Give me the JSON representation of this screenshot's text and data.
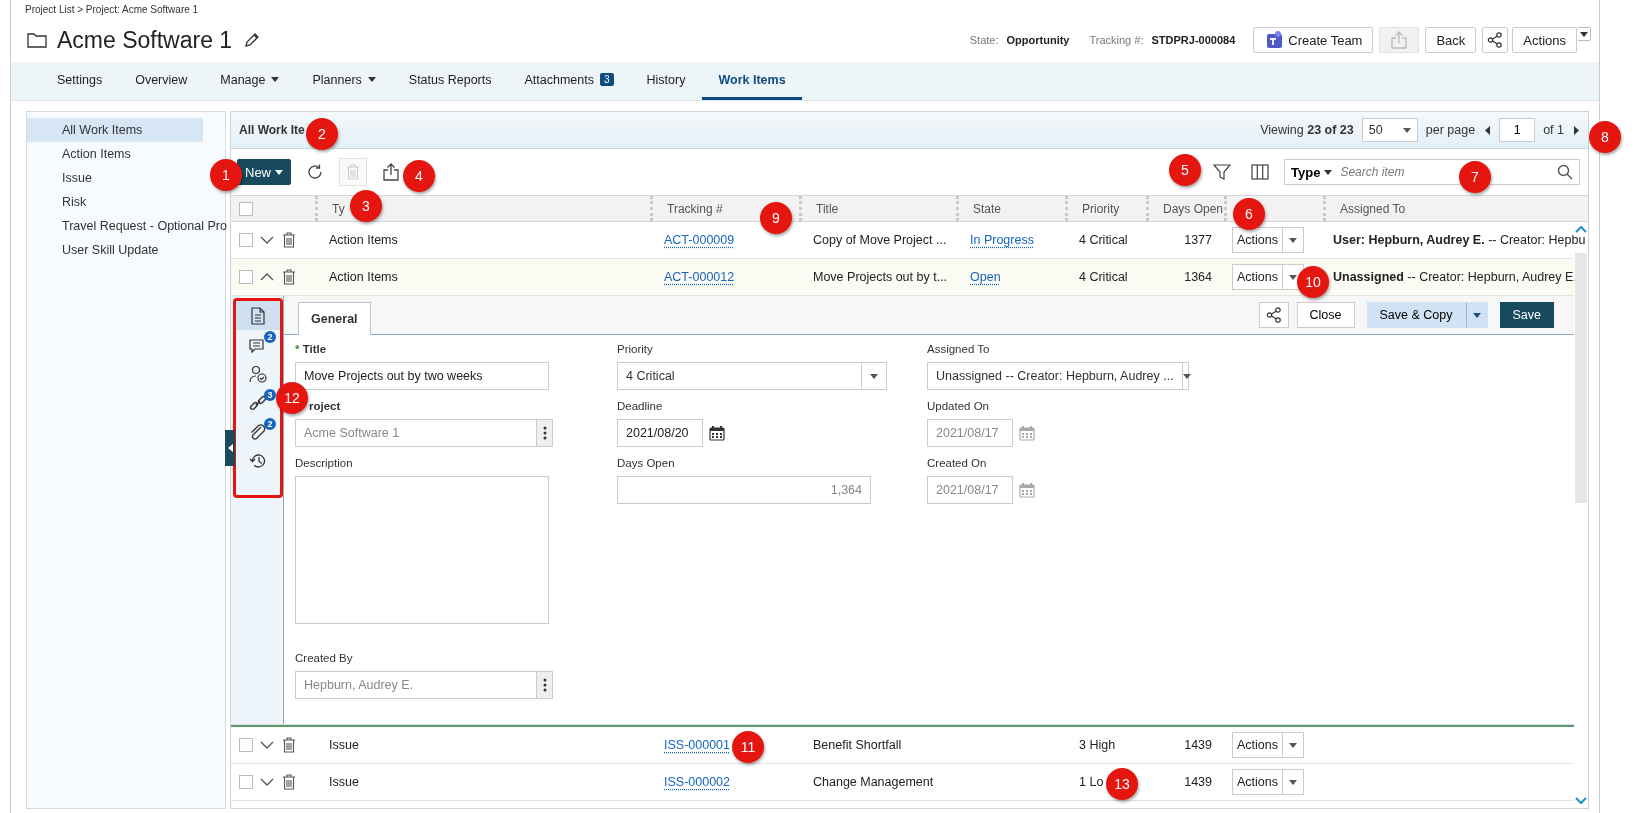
{
  "breadcrumb": "Project List > Project: Acme Software 1",
  "title": "Acme Software 1",
  "header": {
    "state_label": "State:",
    "state": "Opportunity",
    "tracking_label": "Tracking #:",
    "tracking": "STDPRJ-000084",
    "buttons": [
      {
        "kind": "teams",
        "label": "Create Team"
      },
      {
        "kind": "export",
        "disabled": true
      },
      {
        "kind": "text",
        "label": "Back"
      },
      {
        "kind": "share"
      },
      {
        "kind": "split",
        "label": "Actions"
      }
    ]
  },
  "nav_tabs": [
    {
      "label": "Settings",
      "selected": false
    },
    {
      "label": "Overview",
      "selected": false
    },
    {
      "label": "Manage",
      "selected": false,
      "menu": true
    },
    {
      "label": "Planners",
      "selected": false,
      "menu": true
    },
    {
      "label": "Status Reports",
      "selected": false
    },
    {
      "label": "Attachments",
      "selected": false,
      "badge": "3"
    },
    {
      "label": "History",
      "selected": false
    },
    {
      "label": "Work Items",
      "selected": true
    }
  ],
  "sidebar": {
    "items": [
      {
        "label": "All Work Items",
        "selected": true
      },
      {
        "label": "Action Items",
        "selected": false
      },
      {
        "label": "Issue",
        "selected": false
      },
      {
        "label": "Risk",
        "selected": false
      },
      {
        "label": "Travel Request - Optional Pro",
        "selected": false
      },
      {
        "label": "User Skill Update",
        "selected": false
      }
    ]
  },
  "grid": {
    "title": "All Work Ite",
    "viewing": "Viewing **23 of 23**",
    "per_page_value": "50",
    "per_page_label": "per page",
    "page": "1",
    "page_count": "of 1",
    "toolbar": [
      {
        "kind": "new",
        "label": "New"
      },
      {
        "kind": "refresh",
        "disabled": false
      },
      {
        "kind": "delete",
        "disabled": true
      },
      {
        "kind": "export",
        "disabled": false
      }
    ],
    "search": {
      "type_label": "Type",
      "placeholder": "Search item"
    },
    "header_checked": false,
    "columns": [
      {
        "kind": "text",
        "label": "Ty"
      },
      {
        "kind": "text",
        "label": "Tracking #"
      },
      {
        "kind": "text",
        "label": "Title"
      },
      {
        "kind": "text",
        "label": "State"
      },
      {
        "kind": "text",
        "label": "Priority"
      },
      {
        "kind": "text",
        "label": "Days Open"
      },
      {
        "kind": "blank"
      },
      {
        "kind": "text",
        "label": "Assigned To"
      }
    ],
    "rows": [
      {
        "checked": false,
        "expanded": false,
        "type": "Action Items",
        "tracking": "ACT-000009",
        "title": "Copy of Move Project ...",
        "state": "In Progress",
        "priority": "4 Critical",
        "days_open": "1377",
        "action": "Actions",
        "assigned": "**User: Hepburn, Audrey E.** -- Creator: Hepbu"
      },
      {
        "checked": false,
        "expanded": true,
        "type": "Action Items",
        "tracking": "ACT-000012",
        "title": "Move Projects out by t...",
        "state": "Open",
        "priority": "4 Critical",
        "days_open": "1364",
        "action": "Actions",
        "assigned": "**Unassigned** -- Creator: Hepburn, Audrey E."
      },
      {
        "checked": false,
        "expanded": false,
        "type": "Issue",
        "tracking": "ISS-000001",
        "title": "Benefit Shortfall",
        "priority": "3 High",
        "days_open": "1439",
        "action": "Actions"
      },
      {
        "checked": false,
        "expanded": false,
        "type": "Issue",
        "tracking": "ISS-000002",
        "title": "Change Management",
        "priority": "1 Lo",
        "days_open": "1439",
        "action": "Actions"
      }
    ]
  },
  "detail": {
    "side_icons": [
      {
        "kind": "document",
        "selected": true
      },
      {
        "kind": "comments",
        "badge": "2",
        "selected": false
      },
      {
        "kind": "user-check",
        "selected": false
      },
      {
        "kind": "link",
        "badge": "3",
        "selected": false
      },
      {
        "kind": "paperclip",
        "badge": "2",
        "selected": false
      },
      {
        "kind": "history",
        "selected": false
      }
    ],
    "tabs": [
      {
        "label": "General",
        "selected": true
      }
    ],
    "buttons": [
      {
        "kind": "share"
      },
      {
        "kind": "close",
        "label": "Close"
      },
      {
        "kind": "split",
        "label": "Save & Copy"
      },
      {
        "kind": "primary",
        "label": "Save"
      }
    ],
    "columns": [
      [
        {
          "kind": "text",
          "label": "Title",
          "marker": "*",
          "required": true,
          "value": "Move Projects out by two weeks",
          "disabled": false
        },
        {
          "kind": "picker",
          "label": "roject",
          "required": true,
          "value": "Acme Software 1",
          "disabled": true
        },
        {
          "kind": "textarea",
          "label": "Description",
          "required": false
        },
        {
          "kind": "picker",
          "label": "Created By",
          "required": false,
          "value": "Hepburn, Audrey E.",
          "disabled": true
        }
      ],
      [
        {
          "kind": "select",
          "label": "Priority",
          "required": false,
          "value": "4 Critical",
          "disabled": false
        },
        {
          "kind": "date",
          "label": "Deadline",
          "required": false,
          "value": "2021/08/20",
          "disabled": false
        },
        {
          "kind": "number",
          "label": "Days Open",
          "required": false,
          "value": "1,364",
          "disabled": true
        }
      ],
      [
        {
          "kind": "select",
          "label": "Assigned To",
          "required": false,
          "value": "Unassigned -- Creator: Hepburn, Audrey ...",
          "disabled": false
        },
        {
          "kind": "date",
          "label": "Updated On",
          "required": false,
          "value": "2021/08/17",
          "disabled": true
        },
        {
          "kind": "date",
          "label": "Created On",
          "required": false,
          "value": "2021/08/17",
          "disabled": true
        }
      ]
    ]
  },
  "callouts": [
    {
      "number": "1"
    },
    {
      "number": "2"
    },
    {
      "number": "3"
    },
    {
      "number": "4"
    },
    {
      "number": "5"
    },
    {
      "number": "6"
    },
    {
      "number": "7"
    },
    {
      "number": "8"
    },
    {
      "number": "9"
    },
    {
      "number": "10"
    },
    {
      "number": "11"
    },
    {
      "number": "12"
    },
    {
      "number": "13"
    }
  ]
}
